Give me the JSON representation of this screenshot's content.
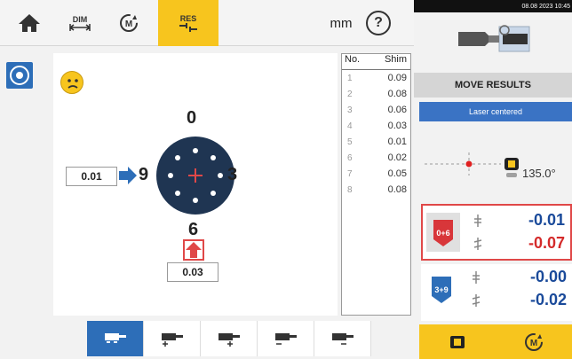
{
  "toolbar": {
    "dim_label": "DIM",
    "res_label": "RES",
    "unit_label": "mm",
    "help_label": "?"
  },
  "shim_table": {
    "headers": {
      "no": "No.",
      "shim": "Shim"
    },
    "rows": [
      {
        "no": "1",
        "shim": "0.09"
      },
      {
        "no": "2",
        "shim": "0.08"
      },
      {
        "no": "3",
        "shim": "0.06"
      },
      {
        "no": "4",
        "shim": "0.03"
      },
      {
        "no": "5",
        "shim": "0.01"
      },
      {
        "no": "6",
        "shim": "0.02"
      },
      {
        "no": "7",
        "shim": "0.05"
      },
      {
        "no": "8",
        "shim": "0.08"
      }
    ]
  },
  "diagram": {
    "label_top": "0",
    "label_left": "9",
    "label_right": "3",
    "label_bottom": "6",
    "value_left": "0.01",
    "value_bottom": "0.03"
  },
  "right_panel": {
    "status_text": "08.08 2023 10:45",
    "title": "MOVE RESULTS",
    "laser_status": "Laser centered",
    "angle": "135.0°",
    "vertical": {
      "icon_label": "0+6",
      "offset": "-0.01",
      "angle": "-0.07"
    },
    "horizontal": {
      "icon_label": "3+9",
      "offset": "-0.00",
      "angle": "-0.02"
    }
  },
  "colors": {
    "accent_yellow": "#f7c51e",
    "accent_blue": "#2d6eb8",
    "alert_red": "#e04848"
  }
}
